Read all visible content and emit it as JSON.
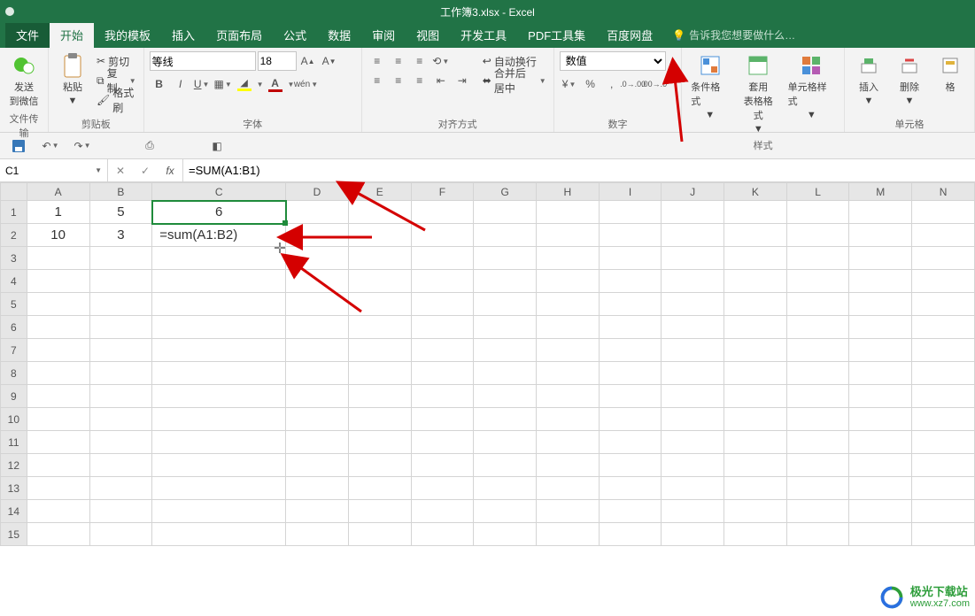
{
  "title": "工作簿3.xlsx - Excel",
  "tabs": {
    "file": "文件",
    "home": "开始",
    "mytpl": "我的模板",
    "insert": "插入",
    "layout": "页面布局",
    "formula": "公式",
    "data": "数据",
    "review": "审阅",
    "view": "视图",
    "dev": "开发工具",
    "pdf": "PDF工具集",
    "baidu": "百度网盘",
    "tell": "告诉我您想要做什么…"
  },
  "ribbon": {
    "send_wx": "发送\n到微信",
    "paste": "粘贴",
    "cut": "剪切",
    "copy": "复制",
    "format_painter": "格式刷",
    "clipboard": "剪贴板",
    "file_transfer": "文件传输",
    "font_name": "等线",
    "font_size": "18",
    "font_group": "字体",
    "wrap": "自动换行",
    "merge": "合并后居中",
    "align_group": "对齐方式",
    "num_format": "数值",
    "number_group": "数字",
    "cond_fmt": "条件格式",
    "table_fmt": "套用\n表格格式",
    "cell_style": "单元格样式",
    "style_group": "样式",
    "insert_cell": "插入",
    "delete_cell": "删除",
    "format_cell": "格",
    "cell_group": "单元格",
    "pct": "%",
    "comma": ",",
    "dec_inc": "",
    "dec_dec": "",
    "cny": "¥"
  },
  "fx": {
    "name": "C1",
    "formula": "=SUM(A1:B1)"
  },
  "cols": [
    "A",
    "B",
    "C",
    "D",
    "E",
    "F",
    "G",
    "H",
    "I",
    "J",
    "K",
    "L",
    "M",
    "N"
  ],
  "rows": [
    "1",
    "2",
    "3",
    "4",
    "5",
    "6",
    "7",
    "8",
    "9",
    "10",
    "11",
    "12",
    "13",
    "14",
    "15"
  ],
  "cells": {
    "A1": "1",
    "B1": "5",
    "C1": "6",
    "A2": "10",
    "B2": "3",
    "C2": "=sum(A1:B2)"
  },
  "wm": {
    "brand": "极光下载站",
    "url": "www.xz7.com"
  },
  "colors": {
    "accent": "#217346",
    "sel": "#1f8b3b",
    "red": "#d40000",
    "fontcolor": "#c00000",
    "fill": "#ffff00"
  }
}
